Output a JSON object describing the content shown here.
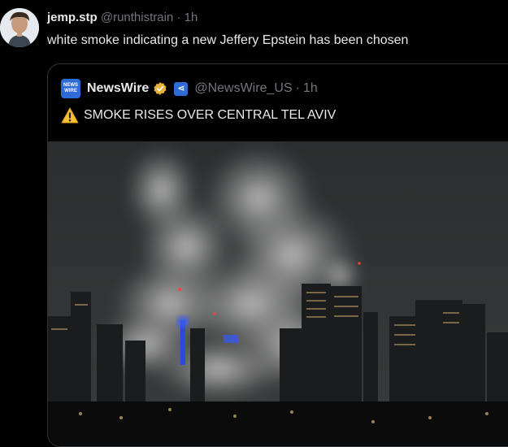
{
  "post": {
    "display_name": "jemp.stp",
    "handle": "@runthistrain",
    "separator": "·",
    "time": "1h",
    "text": "white smoke indicating a new Jeffery Epstein has been chosen"
  },
  "quote": {
    "logo_text_top": "NEWS",
    "logo_text_bottom": "WIRE",
    "display_name": "NewsWire",
    "affiliate_icon_glyph": "⋖",
    "handle": "@NewsWire_US",
    "separator": "·",
    "time": "1h",
    "text": "SMOKE RISES OVER CENTRAL TEL AVIV",
    "icons": [
      "verified-badge-icon",
      "affiliate-badge-icon",
      "warning-icon"
    ]
  },
  "colors": {
    "background": "#000000",
    "text": "#e7e9ea",
    "muted": "#71767b",
    "border": "#2f3336",
    "verified_gold": "#e8b33c",
    "brand_blue": "#2f6bd6"
  }
}
